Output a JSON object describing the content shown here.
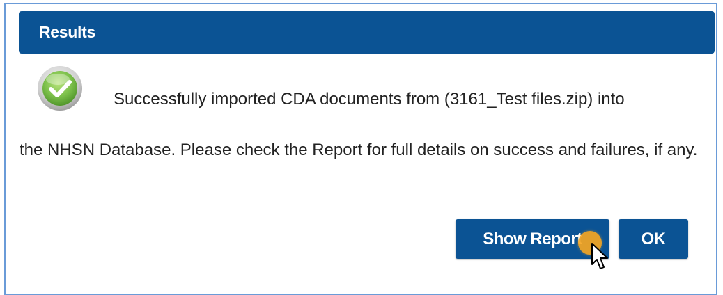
{
  "dialog": {
    "title": "Results",
    "message_line1": "Successfully imported CDA documents from (3161_Test files.zip) into",
    "message_rest": "the NHSN Database. Please check the Report for full details on success and failures, if any.",
    "icon": "success-check-icon",
    "buttons": {
      "show_report_label": "Show Report",
      "ok_label": "OK"
    }
  },
  "colors": {
    "header_bg": "#0b5394",
    "button_bg": "#0b5394",
    "border": "#6a9bd8",
    "success_green": "#7cc04b",
    "click_highlight": "#f5a623"
  },
  "pointer": {
    "icon": "mouse-cursor-icon",
    "highlight": "click-indicator"
  }
}
